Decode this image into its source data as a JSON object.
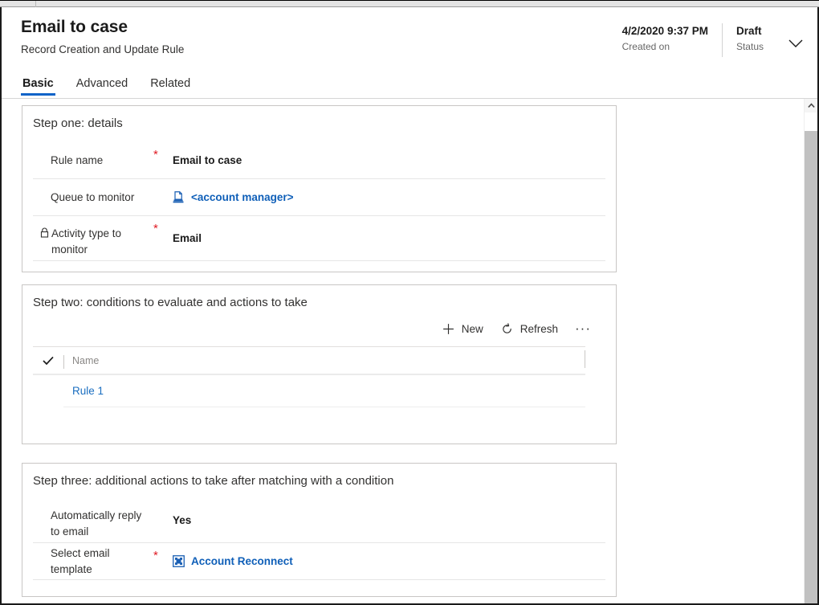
{
  "header": {
    "title": "Email to case",
    "subtitle": "Record Creation and Update Rule",
    "created_value": "4/2/2020 9:37 PM",
    "created_label": "Created on",
    "status_value": "Draft",
    "status_label": "Status",
    "expand_icon": "chevron-down-icon"
  },
  "tabs": [
    {
      "label": "Basic",
      "active": true
    },
    {
      "label": "Advanced",
      "active": false
    },
    {
      "label": "Related",
      "active": false
    }
  ],
  "step_one": {
    "title": "Step one: details",
    "fields": [
      {
        "label": "Rule name",
        "required": "*",
        "value": "Email to case",
        "icon": null,
        "locked": false,
        "link": false
      },
      {
        "label": "Queue to monitor",
        "required": "",
        "value": "<account manager>",
        "icon": "queue-icon",
        "locked": false,
        "link": true
      },
      {
        "label": "Activity type to monitor",
        "required": "*",
        "value": "Email",
        "icon": null,
        "locked": true,
        "lock_icon": "lock-icon",
        "link": false
      }
    ]
  },
  "step_two": {
    "title": "Step two: conditions to evaluate and actions to take",
    "commands": [
      {
        "label": "New",
        "icon": "plus-icon"
      },
      {
        "label": "Refresh",
        "icon": "refresh-icon"
      }
    ],
    "overflow_label": "···",
    "grid": {
      "select_all_icon": "checkmark-icon",
      "columns": [
        "Name"
      ],
      "rows": [
        {
          "name": "Rule 1"
        }
      ]
    }
  },
  "step_three": {
    "title": "Step three: additional actions to take after matching with a condition",
    "fields": [
      {
        "label": "Automatically reply to email",
        "required": "",
        "value": "Yes",
        "icon": null,
        "link": false
      },
      {
        "label": "Select email template",
        "required": "*",
        "value": "Account Reconnect",
        "icon": "email-template-icon",
        "link": true
      }
    ]
  },
  "scrollbar": {
    "up_icon": "scroll-up-arrow-icon",
    "down_icon": "scroll-down-arrow-icon"
  },
  "colors": {
    "accent": "#0f63c8",
    "link": "#0f5fb8",
    "required": "#e01b24",
    "border": "#c8c6c4"
  }
}
